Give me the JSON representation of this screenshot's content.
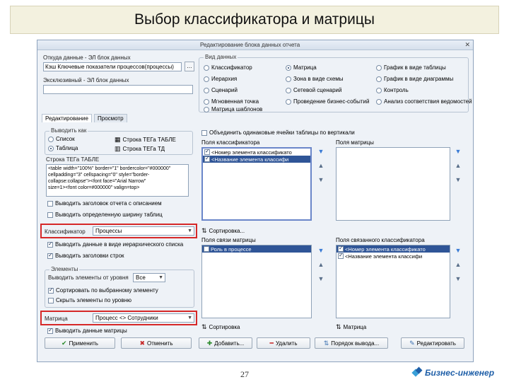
{
  "slide": {
    "title": "Выбор классификатора и матрицы",
    "page_number": "27",
    "brand": "Бизнес-инженер"
  },
  "window": {
    "title": "Редактирование блока данных отчета",
    "close_glyph": "✕"
  },
  "fields": {
    "source_label": "Откуда данные - ЭЛ блок данных",
    "source_value": "Кэш Ключевые показатели процессов(процессы)",
    "source_button": "…",
    "key_label": "Эксклюзивный - ЭЛ блок данных",
    "key_value": ""
  },
  "view_group": {
    "caption": "Вид данных",
    "options": [
      {
        "label": "Классификатор",
        "selected": false
      },
      {
        "label": "Матрица",
        "selected": true
      },
      {
        "label": "График в виде таблицы",
        "selected": false
      },
      {
        "label": "Иерархия",
        "selected": false
      },
      {
        "label": "Зона в виде схемы",
        "selected": false
      },
      {
        "label": "График в виде диаграммы",
        "selected": false
      },
      {
        "label": "Сценарий",
        "selected": false
      },
      {
        "label": "Сетевой сценарий",
        "selected": false
      },
      {
        "label": "Контроль",
        "selected": false
      },
      {
        "label": "Мгновенная точка",
        "selected": false
      },
      {
        "label": "Проведение бизнес-событий",
        "selected": false
      },
      {
        "label": "Анализ соответствия ведомостей",
        "selected": false
      },
      {
        "label": "Матрица шаблонов",
        "selected": false
      }
    ]
  },
  "tabs": [
    {
      "label": "Редактирование",
      "active": true
    },
    {
      "label": "Просмотр",
      "active": false
    }
  ],
  "left": {
    "out_group_caption": "Выводить как",
    "out_options": [
      {
        "label": "Список",
        "selected": false
      },
      {
        "label": "Таблица",
        "selected": true
      }
    ],
    "format_line": "Строка ТЕГа ТАБЛЕ",
    "format_opt1": "Строка ТЕГа ТАБЛЕ",
    "format_opt2": "Строка ТЕГа ТД",
    "code_lines": [
      "<table width=\"100%\" border=\"1\" bordercolor=\"#000000\"",
      "cellpadding=\"3\" cellspacing=\"0\" style=\"border-",
      "collapse:collapse\"><font face=\"Arial Narrow\"",
      "size=1><font color=#000000\" valign=top>"
    ],
    "check_a": "Выводить заголовок отчета с описанием",
    "check_b": "Выводить определенную ширину таблиц",
    "classifier_label": "Классификатор",
    "classifier_value": "Процессы",
    "check_c": "Выводить данные в виде иерархического списка",
    "check_d": "Выводить заголовки строк",
    "elements_caption": "Элементы",
    "show_label": "Выводить элементы от уровня",
    "show_value": "Все",
    "check_e": "Сортировать по выбранному элементу",
    "check_f": "Скрыть элементы по уровню",
    "matrix_label": "Матрица",
    "matrix_value": "Процесс <> Сотрудники",
    "check_g": "Выводить данные матрицы"
  },
  "right": {
    "check_merge": "Объединить одинаковые ячейки таблицы по вертикали",
    "cls_fields_header": "Поля классификатора",
    "cls_fields": [
      {
        "label": "<Номер элемента классификато",
        "checked": true,
        "selected": false
      },
      {
        "label": "<Название элемента классифи",
        "checked": true,
        "selected": true
      }
    ],
    "matrix_fields_header": "Поля матрицы",
    "sort_label": "Сортировка...",
    "link_fields_header": "Поля связи матрицы",
    "link_fields": [
      {
        "label": "Роль в процессе",
        "checked": false,
        "selected": true
      }
    ],
    "linked_cls_header": "Поля связанного классификатора",
    "linked_cls": [
      {
        "label": "<Номер элемента классификато",
        "checked": true,
        "selected": true
      },
      {
        "label": "<Название элемента классифи",
        "checked": true,
        "selected": false
      }
    ],
    "sort_label2": "Сортировка",
    "matrix_label2": "Матрица"
  },
  "buttons": {
    "apply": "Применить",
    "cancel": "Отменить",
    "add": "Добавить...",
    "delete": "Удалить",
    "order": "Порядок вывода...",
    "edit": "Редактировать"
  },
  "colors": {
    "highlight": "#d62828",
    "selection": "#2f5597",
    "title_bg": "#f3f1df",
    "brand": "#1f5fa8"
  }
}
